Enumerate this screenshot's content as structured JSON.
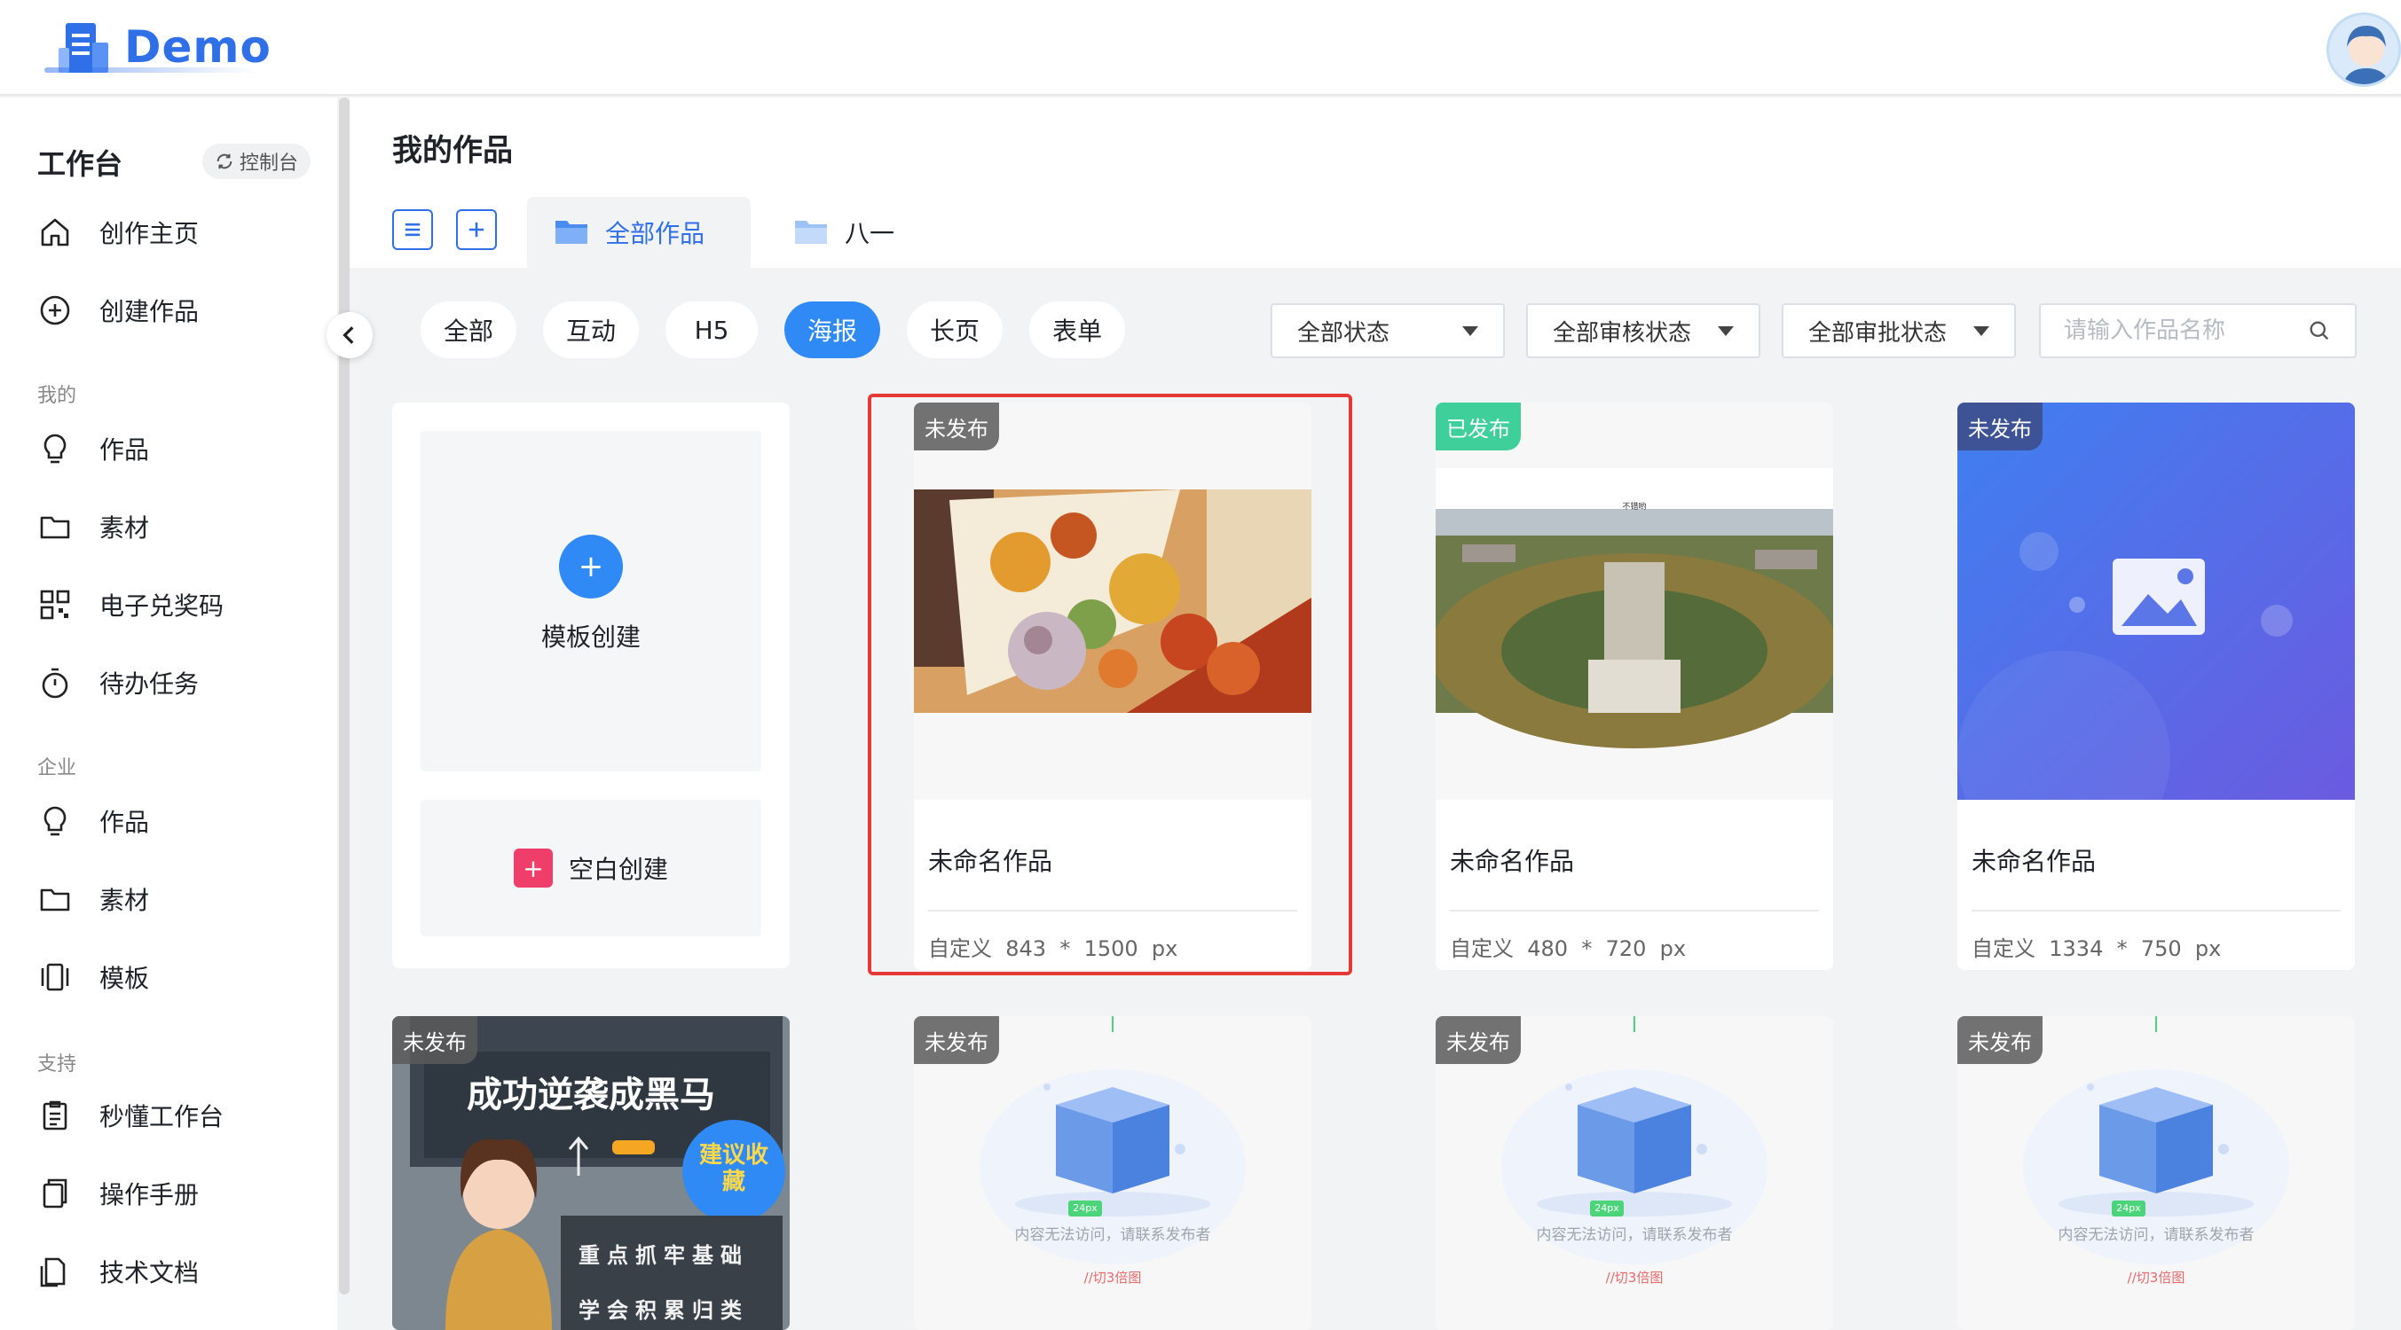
{
  "app": {
    "logo_text": "Demo"
  },
  "sidebar": {
    "workspace_title": "工作台",
    "control_btn": "控制台",
    "top_items": [
      {
        "label": "创作主页"
      },
      {
        "label": "创建作品"
      }
    ],
    "sections": [
      {
        "label": "我的",
        "items": [
          {
            "label": "作品"
          },
          {
            "label": "素材"
          },
          {
            "label": "电子兑奖码"
          },
          {
            "label": "待办任务"
          }
        ]
      },
      {
        "label": "企业",
        "items": [
          {
            "label": "作品"
          },
          {
            "label": "素材"
          },
          {
            "label": "模板"
          }
        ]
      },
      {
        "label": "支持",
        "items": [
          {
            "label": "秒懂工作台"
          },
          {
            "label": "操作手册"
          },
          {
            "label": "技术文档"
          }
        ]
      }
    ]
  },
  "main": {
    "title": "我的作品",
    "folders": [
      {
        "label": "全部作品",
        "active": true
      },
      {
        "label": "八一",
        "active": false
      }
    ],
    "type_filters": [
      "全部",
      "互动",
      "H5",
      "海报",
      "长页",
      "表单"
    ],
    "active_type": "海报",
    "selects": [
      "全部状态",
      "全部审核状态",
      "全部审批状态"
    ],
    "search_placeholder": "请输入作品名称",
    "create_card": {
      "template_label": "模板创建",
      "blank_label": "空白创建"
    },
    "works": [
      {
        "status": "未发布",
        "name": "未命名作品",
        "size": "自定义  843  *  1500  px"
      },
      {
        "status": "已发布",
        "name": "未命名作品",
        "size": "自定义  480  *  720  px",
        "thumb_caption": "不错哟"
      },
      {
        "status": "未发布",
        "name": "未命名作品",
        "size": "自定义  1334  *  750  px"
      }
    ],
    "row2": [
      {
        "status": "未发布",
        "poster_title": "成功逆袭成黑马",
        "poster_sticker": "建议收藏",
        "poster_line1": "重点抓牢基础",
        "poster_line2": "学会积累归类"
      },
      {
        "status": "未发布",
        "empty_text": "内容无法访问，请联系发布者",
        "dim": "24px",
        "note": "//切3倍图"
      },
      {
        "status": "未发布",
        "empty_text": "内容无法访问，请联系发布者",
        "dim": "24px",
        "note": "//切3倍图"
      },
      {
        "status": "未发布",
        "empty_text": "内容无法访问，请联系发布者",
        "dim": "24px",
        "note": "//切3倍图"
      }
    ]
  }
}
